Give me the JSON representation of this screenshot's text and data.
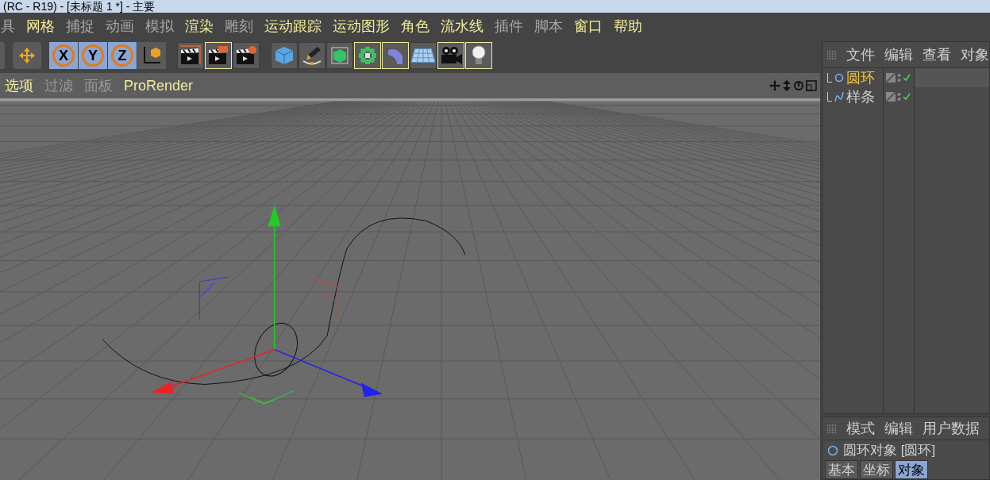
{
  "window": {
    "title": "(RC - R19) - [未标题 1 *] - 主要"
  },
  "menu": [
    {
      "label": "具",
      "enabled": false
    },
    {
      "label": "网格",
      "enabled": true
    },
    {
      "label": "捕捉",
      "enabled": false
    },
    {
      "label": "动画",
      "enabled": false
    },
    {
      "label": "模拟",
      "enabled": false
    },
    {
      "label": "渲染",
      "enabled": true
    },
    {
      "label": "雕刻",
      "enabled": false
    },
    {
      "label": "运动跟踪",
      "enabled": true
    },
    {
      "label": "运动图形",
      "enabled": true
    },
    {
      "label": "角色",
      "enabled": true
    },
    {
      "label": "流水线",
      "enabled": true
    },
    {
      "label": "插件",
      "enabled": false
    },
    {
      "label": "脚本",
      "enabled": false
    },
    {
      "label": "窗口",
      "enabled": true
    },
    {
      "label": "帮助",
      "enabled": true
    }
  ],
  "axis_buttons": [
    {
      "label": "X",
      "selected": true
    },
    {
      "label": "Y",
      "selected": true
    },
    {
      "label": "Z",
      "selected": true
    }
  ],
  "toolbar_groups": [
    [
      {
        "kind": "render-view",
        "highlighted": false
      },
      {
        "kind": "render-picture",
        "highlighted": true
      },
      {
        "kind": "render-settings",
        "highlighted": false
      }
    ],
    [
      {
        "kind": "cube",
        "highlighted": false
      },
      {
        "kind": "pen",
        "highlighted": false
      },
      {
        "kind": "subdivision",
        "highlighted": false
      },
      {
        "kind": "cloner",
        "highlighted": true
      },
      {
        "kind": "deformer",
        "highlighted": true
      },
      {
        "kind": "floor",
        "highlighted": false
      },
      {
        "kind": "camera",
        "highlighted": true
      },
      {
        "kind": "light",
        "highlighted": true
      }
    ]
  ],
  "viewport_menu": [
    {
      "label": "选项",
      "enabled": true
    },
    {
      "label": "过滤",
      "enabled": false
    },
    {
      "label": "面板",
      "enabled": false
    },
    {
      "label": "ProRender",
      "enabled": true
    }
  ],
  "object_manager": {
    "menu": [
      "文件",
      "编辑",
      "查看",
      "对象"
    ],
    "objects": [
      {
        "name": "圆环",
        "kind": "circle",
        "selected": true
      },
      {
        "name": "样条",
        "kind": "spline",
        "selected": false
      }
    ]
  },
  "attribute_manager": {
    "menu": [
      "模式",
      "编辑",
      "用户数据"
    ],
    "object_title": "圆环对象 [圆环]",
    "tabs": [
      {
        "label": "基本",
        "selected": false
      },
      {
        "label": "坐标",
        "selected": false
      },
      {
        "label": "对象",
        "selected": true
      }
    ]
  }
}
